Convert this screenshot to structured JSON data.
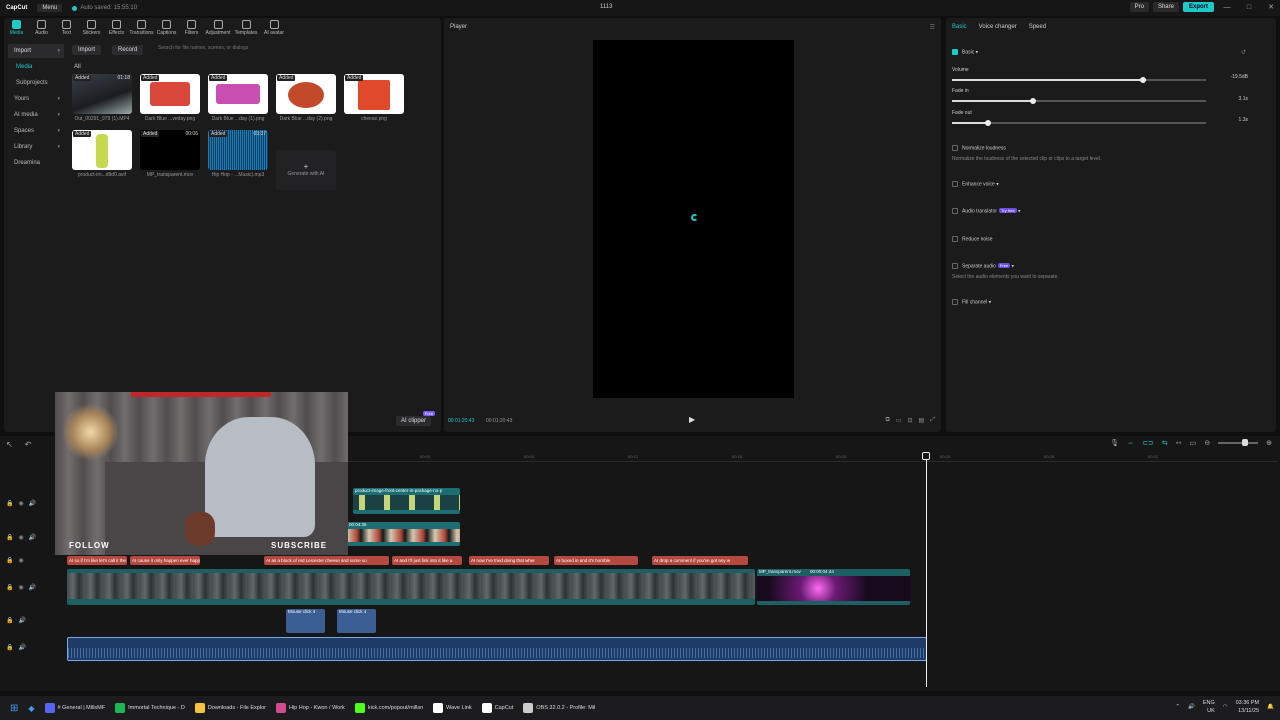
{
  "titlebar": {
    "app_name": "CapCut",
    "menu_label": "Menu",
    "autosave": "Auto saved: 15:55:10",
    "project_name": "1113",
    "pro_label": "Pro",
    "share_label": "Share",
    "export_label": "Export"
  },
  "toolbar": {
    "items": [
      "Media",
      "Audio",
      "Text",
      "Stickers",
      "Effects",
      "Transitions",
      "Captions",
      "Filters",
      "Adjustment",
      "Templates",
      "AI avatar"
    ]
  },
  "sidebar": {
    "items": [
      "Import",
      "Media",
      "Subprojects",
      "Yours",
      "AI media",
      "Spaces",
      "Library",
      "Dreamina"
    ]
  },
  "media": {
    "import_label": "Import",
    "record_label": "Record",
    "search_placeholder": "Search for file names, scenes, or dialogs",
    "all_label": "All",
    "added_badge": "Added",
    "items": [
      {
        "label": "Out_00291_979 (1).MP4",
        "duration": "01:18"
      },
      {
        "label": "Dark Blue ...veday.png",
        "duration": ""
      },
      {
        "label": "Dark Blue ...day (1).png",
        "duration": ""
      },
      {
        "label": "Dark Blue ...day (2).png",
        "duration": ""
      },
      {
        "label": "cheese.png",
        "duration": ""
      },
      {
        "label": "product-im...d9d0.avif",
        "duration": ""
      },
      {
        "label": "MP_transparent.mov",
        "duration": "00:06"
      },
      {
        "label": "Hip Hop - ...Music).mp3",
        "duration": "03:37"
      }
    ],
    "generate_label": "Generate with AI",
    "ai_clipper_label": "AI clipper",
    "ai_clipper_badge": "Free"
  },
  "player": {
    "title": "Player",
    "timecode_current": "00:01:20:43",
    "timecode_total": "00:01:20:43"
  },
  "right": {
    "tabs": [
      "Basic",
      "Voice changer",
      "Speed"
    ],
    "basic_label": "Basic",
    "volume_label": "Volume",
    "volume_value": "-19.5dB",
    "volume_level": 0.75,
    "fadein_label": "Fade in",
    "fadein_value": "3.1s",
    "fadein_level": 0.32,
    "fadeout_label": "Fade out",
    "fadeout_value": "1.3s",
    "fadeout_level": 0.14,
    "normalize_label": "Normalize loudness",
    "normalize_desc": "Normalize the loudness of the selected clip or clips to a target level.",
    "enhance_label": "Enhance voice",
    "translator_label": "Audio translator",
    "translator_badge": "Try free",
    "reduce_label": "Reduce noise",
    "separate_label": "Separate audio",
    "separate_badge": "Free",
    "separate_desc": "Select the audio elements you want to separate.",
    "fill_label": "Fill channel"
  },
  "timeline": {
    "ruler": [
      "00:00",
      "00:04",
      "00:12",
      "00:16",
      "00:20",
      "00:24",
      "00:28",
      "00:32"
    ],
    "clip_product": "product-image-front-center-in-package-no-p",
    "clip_short_dur": "00:04:36",
    "captions": [
      "AI so if I'm like let's call it the middl",
      "AI cause it only happen ever happens late on",
      "AI as a block of red Leicester cheese and some so",
      "AI and I'll just link into it like a",
      "AI now I've tried doing that wher",
      "AI boxed in and it's horrible",
      "AI drop a comment if you've got any w"
    ],
    "clip_mp": "MP_transparent.mov",
    "clip_mp_dur": "00:00:04:44",
    "sfx1": "Mouse click 4",
    "sfx2": "Mouse click 4"
  },
  "webcam": {
    "follow": "FOLLOW",
    "subscribe": "SUBSCRIBE"
  },
  "taskbar": {
    "items": [
      {
        "label": "# General | MillsMF",
        "color": "#5865f2"
      },
      {
        "label": "Immortal Technique - D",
        "color": "#1db954"
      },
      {
        "label": "Downloads - File Explor",
        "color": "#f5c242"
      },
      {
        "label": "Hip Hop - Kwon / Work",
        "color": "#d14b8f"
      },
      {
        "label": "kick.com/popout/millsn",
        "color": "#53fc18"
      },
      {
        "label": "Wave Link",
        "color": "#ffffff"
      },
      {
        "label": "CapCut",
        "color": "#ffffff"
      },
      {
        "label": "OBS 32.0.2 - Profile: Mil",
        "color": "#cccccc"
      }
    ],
    "lang": "ENG",
    "region": "UK",
    "time": "03:36 PM",
    "date": "13/11/25"
  },
  "colors": {
    "accent": "#1ec9c9",
    "caption": "#b5493f",
    "video": "#1d6e72",
    "audio": "#1e3a66"
  }
}
